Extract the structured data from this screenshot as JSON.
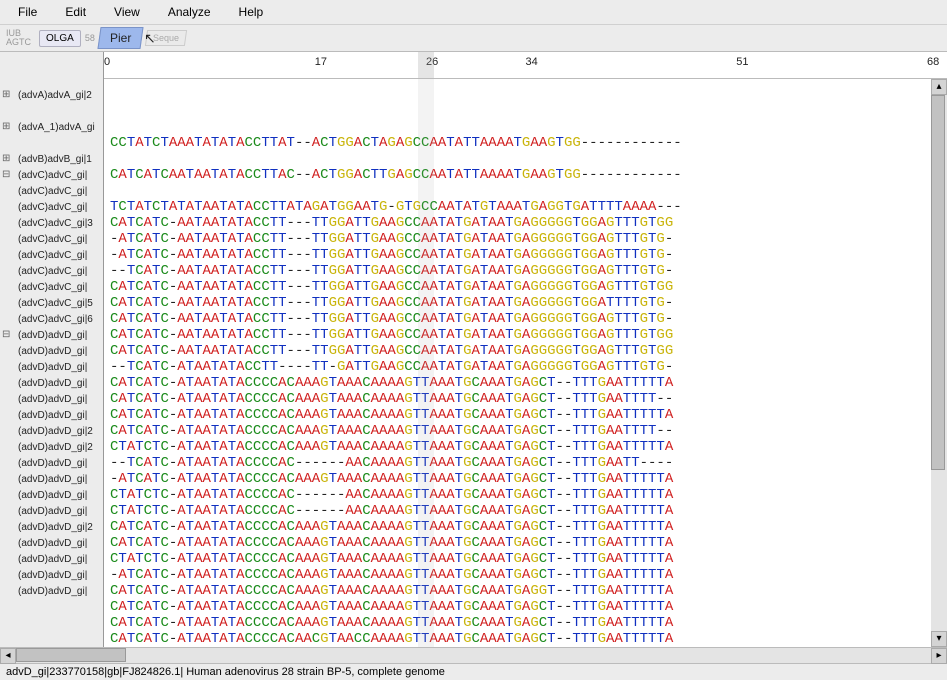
{
  "menu": {
    "items": [
      "File",
      "Edit",
      "View",
      "Analyze",
      "Help"
    ]
  },
  "toolbar": {
    "iub": "IUB",
    "agtc": "AGTC",
    "btn_olga": "OLGA",
    "btn_num": "58",
    "pier": "Pier",
    "seq": "Seque"
  },
  "ruler": {
    "ticks": [
      {
        "pos": 0,
        "label": "0",
        "pct": 0
      },
      {
        "pos": 17,
        "label": "17",
        "pct": 25
      },
      {
        "pos": 26,
        "label": "26",
        "pct": 38.2
      },
      {
        "pos": 34,
        "label": "34",
        "pct": 50
      },
      {
        "pos": 51,
        "label": "51",
        "pct": 75
      },
      {
        "pos": 68,
        "label": "68",
        "pct": 99
      }
    ],
    "grey_start_pct": 37.3,
    "grey_width_pct": 1.8
  },
  "names": [
    {
      "glyph": "⊞",
      "label": "(advA)advA_gi|2",
      "blank_after": 1
    },
    {
      "glyph": "⊞",
      "label": "(advA_1)advA_gi",
      "blank_after": 1
    },
    {
      "glyph": "⊞",
      "label": "(advB)advB_gi|1",
      "blank_after": 0
    },
    {
      "glyph": "⊟",
      "label": "(advC)advC_gi|",
      "blank_after": 0
    },
    {
      "glyph": "├",
      "label": "(advC)advC_gi|",
      "blank_after": 0
    },
    {
      "glyph": "├",
      "label": "(advC)advC_gi|",
      "blank_after": 0
    },
    {
      "glyph": "├",
      "label": "(advC)advC_gi|3",
      "blank_after": 0
    },
    {
      "glyph": "├",
      "label": "(advC)advC_gi|",
      "blank_after": 0
    },
    {
      "glyph": "├",
      "label": "(advC)advC_gi|",
      "blank_after": 0
    },
    {
      "glyph": "├",
      "label": "(advC)advC_gi|",
      "blank_after": 0
    },
    {
      "glyph": "├",
      "label": "(advC)advC_gi|",
      "blank_after": 0
    },
    {
      "glyph": "├",
      "label": "(advC)advC_gi|5",
      "blank_after": 0
    },
    {
      "glyph": "└",
      "label": "(advC)advC_gi|6",
      "blank_after": 0
    },
    {
      "glyph": "⊟",
      "label": "(advD)advD_gi|",
      "blank_after": 0
    },
    {
      "glyph": "├",
      "label": "(advD)advD_gi|",
      "blank_after": 0
    },
    {
      "glyph": "├",
      "label": "(advD)advD_gi|",
      "blank_after": 0
    },
    {
      "glyph": "├",
      "label": "(advD)advD_gi|",
      "blank_after": 0
    },
    {
      "glyph": "├",
      "label": "(advD)advD_gi|",
      "blank_after": 0
    },
    {
      "glyph": "├",
      "label": "(advD)advD_gi|",
      "blank_after": 0
    },
    {
      "glyph": "├",
      "label": "(advD)advD_gi|2",
      "blank_after": 0
    },
    {
      "glyph": "├",
      "label": "(advD)advD_gi|2",
      "blank_after": 0
    },
    {
      "glyph": "├",
      "label": "(advD)advD_gi|",
      "blank_after": 0
    },
    {
      "glyph": "├",
      "label": "(advD)advD_gi|",
      "blank_after": 0
    },
    {
      "glyph": "├",
      "label": "(advD)advD_gi|",
      "blank_after": 0
    },
    {
      "glyph": "├",
      "label": "(advD)advD_gi|",
      "blank_after": 0
    },
    {
      "glyph": "├",
      "label": "(advD)advD_gi|2",
      "blank_after": 0
    },
    {
      "glyph": "├",
      "label": "(advD)advD_gi|",
      "blank_after": 0
    },
    {
      "glyph": "├",
      "label": "(advD)advD_gi|",
      "blank_after": 0
    },
    {
      "glyph": "├",
      "label": "(advD)advD_gi|",
      "blank_after": 0
    },
    {
      "glyph": "├",
      "label": "(advD)advD_gi|",
      "blank_after": 0
    }
  ],
  "sequences": [
    "CCTATCTAAATATATACCTTAT--ACTGGACTAGAGCCAATATTAAAATGAAGTGG------------",
    "",
    "CATCATCAATAATATACCTTAC--ACTGGACTTGAGCCAATATTAAAATGAAGTGG------------",
    "",
    "TCTATCTATATAATATACCTTATAGATGGAATG-GTGCCAATATGTAAATGAGGTGATTTTAAAA---",
    "CATCATC-AATAATATACCTT---TTGGATTGAAGCCAATATGATAATGAGGGGGTGGAGTTTGTGG",
    "-ATCATC-AATAATATACCTT---TTGGATTGAAGCCAATATGATAATGAGGGGGTGGAGTTTGTG-",
    "-ATCATC-AATAATATACCTT---TTGGATTGAAGCCAATATGATAATGAGGGGGTGGAGTTTGTG-",
    "--TCATC-AATAATATACCTT---TTGGATTGAAGCCAATATGATAATGAGGGGGTGGAGTTTGTG-",
    "CATCATC-AATAATATACCTT---TTGGATTGAAGCCAATATGATAATGAGGGGGTGGAGTTTGTGG",
    "CATCATC-AATAATATACCTT---TTGGATTGAAGCCAATATGATAATGAGGGGGTGGATTTTGTG-",
    "CATCATC-AATAATATACCTT---TTGGATTGAAGCCAATATGATAATGAGGGGGTGGAGTTTGTG-",
    "CATCATC-AATAATATACCTT---TTGGATTGAAGCCAATATGATAATGAGGGGGTGGAGTTTGTGG",
    "CATCATC-AATAATATACCTT---TTGGATTGAAGCCAATATGATAATGAGGGGGTGGAGTTTGTGG",
    "--TCATC-ATAATATACCTT----TT-GATTGAAGCCAATATGATAATGAGGGGGTGGAGTTTGTG-",
    "CATCATC-ATAATATACCCCACAAAGTAAACAAAAGTTAAATGCAAATGAGCT--TTTGAATTTTTA",
    "CATCATC-ATAATATACCCCACAAAGTAAACAAAAGTTAAATGCAAATGAGCT--TTTGAATTTT--",
    "CATCATC-ATAATATACCCCACAAAGTAAACAAAAGTTAAATGCAAATGAGCT--TTTGAATTTTTA",
    "CATCATC-ATAATATACCCCACAAAGTAAACAAAAGTTAAATGCAAATGAGCT--TTTGAATTTT--",
    "CTATCTC-ATAATATACCCCACAAAGTAAACAAAAGTTAAATGCAAATGAGCT--TTTGAATTTTTA",
    "--TCATC-ATAATATACCCCAC------AACAAAAGTTAAATGCAAATGAGCT--TTTGAATT----",
    "-ATCATC-ATAATATACCCCACAAAGTAAACAAAAGTTAAATGCAAATGAGCT--TTTGAATTTTTA",
    "CTATCTC-ATAATATACCCCAC------AACAAAAGTTAAATGCAAATGAGCT--TTTGAATTTTTA",
    "CTATCTC-ATAATATACCCCAC------AACAAAAGTTAAATGCAAATGAGCT--TTTGAATTTTTA",
    "CATCATC-ATAATATACCCCACAAAGTAAACAAAAGTTAAATGCAAATGAGCT--TTTGAATTTTTA",
    "CATCATC-ATAATATACCCCACAAAGTAAACAAAAGTTAAATGCAAATGAGCT--TTTGAATTTTTA",
    "CTATCTC-ATAATATACCCCACAAAGTAAACAAAAGTTAAATGCAAATGAGCT--TTTGAATTTTTA",
    "-ATCATC-ATAATATACCCCACAAAGTAAACAAAAGTTAAATGCAAATGAGCT--TTTGAATTTTTA",
    "CATCATC-ATAATATACCCCACAAAGTAAACAAAAGTTAAATGCAAATGAGGT--TTTGAATTTTTA",
    "CATCATC-ATAATATACCCCACAAAGTAAACAAAAGTTAAATGCAAATGAGCT--TTTGAATTTTTA",
    "CATCATC-ATAATATACCCCACAAAGTAAACAAAAGTTAAATGCAAATGAGCT--TTTGAATTTTTA",
    "CATCATC-ATAATATACCCCACAACGTAACCAAAAGTTAAATGCAAATGAGCT--TTTGAATTTTTA"
  ],
  "status": "advD_gi|233770158|gb|FJ824826.1| Human adenovirus 28 strain BP-5, complete genome"
}
